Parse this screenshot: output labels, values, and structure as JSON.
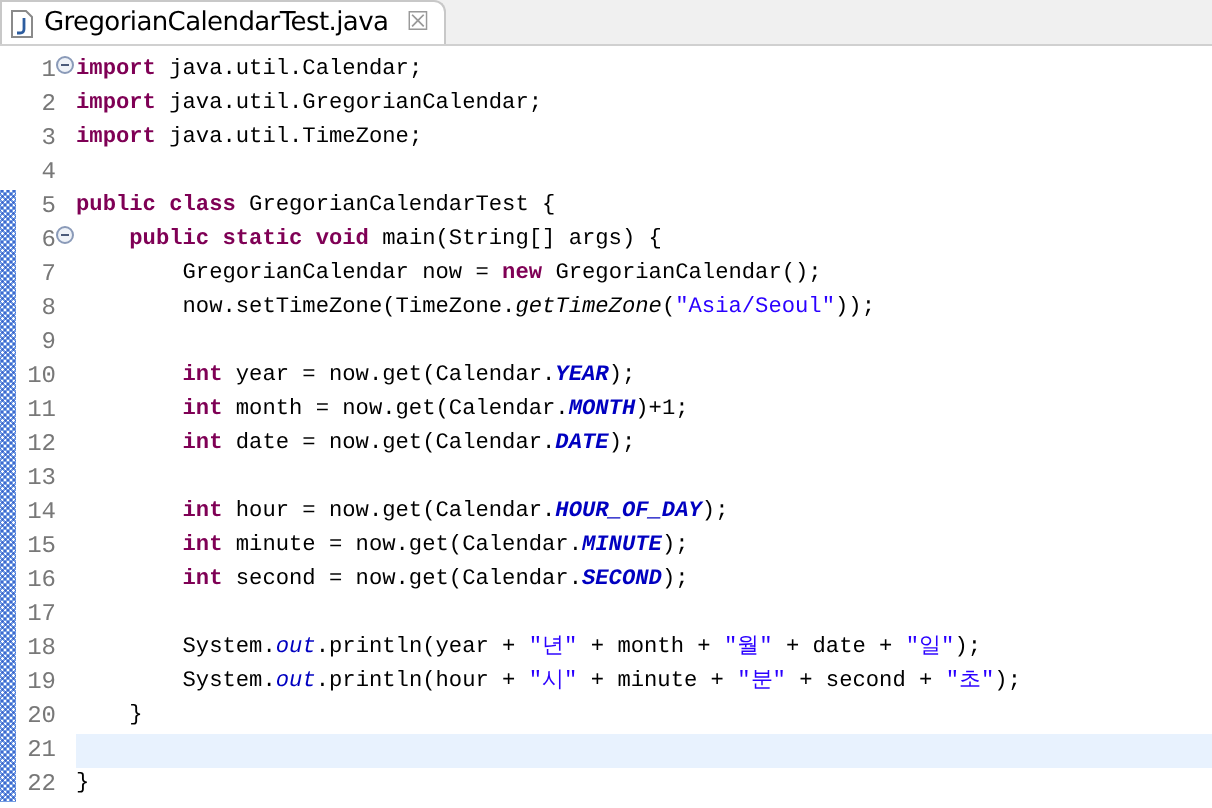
{
  "tab": {
    "title": "GregorianCalendarTest.java",
    "close": "☒",
    "selected": true
  },
  "lines": [
    {
      "number": "1",
      "foldable": true,
      "current": false,
      "changed": false,
      "tokens": [
        {
          "kind": "keyword",
          "text": "import"
        },
        {
          "kind": "plain",
          "text": " java.util.Calendar;"
        }
      ]
    },
    {
      "number": "2",
      "foldable": false,
      "current": false,
      "changed": false,
      "tokens": [
        {
          "kind": "keyword",
          "text": "import"
        },
        {
          "kind": "plain",
          "text": " java.util.GregorianCalendar;"
        }
      ]
    },
    {
      "number": "3",
      "foldable": false,
      "current": false,
      "changed": false,
      "tokens": [
        {
          "kind": "keyword",
          "text": "import"
        },
        {
          "kind": "plain",
          "text": " java.util.TimeZone;"
        }
      ]
    },
    {
      "number": "4",
      "foldable": false,
      "current": false,
      "changed": false
    },
    {
      "number": "5",
      "foldable": false,
      "current": false,
      "changed": true,
      "tokens": [
        {
          "kind": "keyword",
          "text": "public class"
        },
        {
          "kind": "plain",
          "text": " GregorianCalendarTest {"
        }
      ]
    },
    {
      "number": "6",
      "foldable": true,
      "current": false,
      "changed": true,
      "tokens": [
        {
          "kind": "keyword",
          "text": "    public static void"
        },
        {
          "kind": "plain",
          "text": " main(String[] args) {"
        }
      ]
    },
    {
      "number": "7",
      "foldable": false,
      "current": false,
      "changed": true,
      "tokens": [
        {
          "kind": "plain",
          "text": "        GregorianCalendar now = "
        },
        {
          "kind": "keyword",
          "text": "new"
        },
        {
          "kind": "plain",
          "text": " GregorianCalendar();"
        }
      ]
    },
    {
      "number": "8",
      "foldable": false,
      "current": false,
      "changed": true,
      "tokens": [
        {
          "kind": "plain",
          "text": "        now.setTimeZone(TimeZone."
        },
        {
          "kind": "static-method",
          "text": "getTimeZone"
        },
        {
          "kind": "plain",
          "text": "("
        },
        {
          "kind": "string",
          "text": "\"Asia/Seoul\""
        },
        {
          "kind": "plain",
          "text": "));"
        }
      ]
    },
    {
      "number": "9",
      "foldable": false,
      "current": false,
      "changed": true
    },
    {
      "number": "10",
      "foldable": false,
      "current": false,
      "changed": true,
      "tokens": [
        {
          "kind": "keyword",
          "text": "        int"
        },
        {
          "kind": "plain",
          "text": " year = now.get(Calendar."
        },
        {
          "kind": "constant",
          "text": "YEAR"
        },
        {
          "kind": "plain",
          "text": ");"
        }
      ]
    },
    {
      "number": "11",
      "foldable": false,
      "current": false,
      "changed": true,
      "tokens": [
        {
          "kind": "keyword",
          "text": "        int"
        },
        {
          "kind": "plain",
          "text": " month = now.get(Calendar."
        },
        {
          "kind": "constant",
          "text": "MONTH"
        },
        {
          "kind": "plain",
          "text": ")+1;"
        }
      ]
    },
    {
      "number": "12",
      "foldable": false,
      "current": false,
      "changed": true,
      "tokens": [
        {
          "kind": "keyword",
          "text": "        int"
        },
        {
          "kind": "plain",
          "text": " date = now.get(Calendar."
        },
        {
          "kind": "constant",
          "text": "DATE"
        },
        {
          "kind": "plain",
          "text": ");"
        }
      ]
    },
    {
      "number": "13",
      "foldable": false,
      "current": false,
      "changed": true
    },
    {
      "number": "14",
      "foldable": false,
      "current": false,
      "changed": true,
      "tokens": [
        {
          "kind": "keyword",
          "text": "        int"
        },
        {
          "kind": "plain",
          "text": " hour = now.get(Calendar."
        },
        {
          "kind": "constant",
          "text": "HOUR_OF_DAY"
        },
        {
          "kind": "plain",
          "text": ");"
        }
      ]
    },
    {
      "number": "15",
      "foldable": false,
      "current": false,
      "changed": true,
      "tokens": [
        {
          "kind": "keyword",
          "text": "        int"
        },
        {
          "kind": "plain",
          "text": " minute = now.get(Calendar."
        },
        {
          "kind": "constant",
          "text": "MINUTE"
        },
        {
          "kind": "plain",
          "text": ");"
        }
      ]
    },
    {
      "number": "16",
      "foldable": false,
      "current": false,
      "changed": true,
      "tokens": [
        {
          "kind": "keyword",
          "text": "        int"
        },
        {
          "kind": "plain",
          "text": " second = now.get(Calendar."
        },
        {
          "kind": "constant",
          "text": "SECOND"
        },
        {
          "kind": "plain",
          "text": ");"
        }
      ]
    },
    {
      "number": "17",
      "foldable": false,
      "current": false,
      "changed": true
    },
    {
      "number": "18",
      "foldable": false,
      "current": false,
      "changed": true,
      "tokens": [
        {
          "kind": "plain",
          "text": "        System."
        },
        {
          "kind": "field",
          "text": "out"
        },
        {
          "kind": "plain",
          "text": ".println(year + "
        },
        {
          "kind": "string",
          "text": "\"년\""
        },
        {
          "kind": "plain",
          "text": " + month + "
        },
        {
          "kind": "string",
          "text": "\"월\""
        },
        {
          "kind": "plain",
          "text": " + date + "
        },
        {
          "kind": "string",
          "text": "\"일\""
        },
        {
          "kind": "plain",
          "text": ");"
        }
      ]
    },
    {
      "number": "19",
      "foldable": false,
      "current": false,
      "changed": true,
      "tokens": [
        {
          "kind": "plain",
          "text": "        System."
        },
        {
          "kind": "field",
          "text": "out"
        },
        {
          "kind": "plain",
          "text": ".println(hour + "
        },
        {
          "kind": "string",
          "text": "\"시\""
        },
        {
          "kind": "plain",
          "text": " + minute + "
        },
        {
          "kind": "string",
          "text": "\"분\""
        },
        {
          "kind": "plain",
          "text": " + second + "
        },
        {
          "kind": "string",
          "text": "\"초\""
        },
        {
          "kind": "plain",
          "text": ");"
        }
      ]
    },
    {
      "number": "20",
      "foldable": false,
      "current": false,
      "changed": true,
      "tokens": [
        {
          "kind": "plain",
          "text": "    }"
        }
      ]
    },
    {
      "number": "21",
      "foldable": false,
      "current": true,
      "changed": true
    },
    {
      "number": "22",
      "foldable": false,
      "current": false,
      "changed": true,
      "tokens": [
        {
          "kind": "plain",
          "text": "}"
        }
      ]
    }
  ]
}
